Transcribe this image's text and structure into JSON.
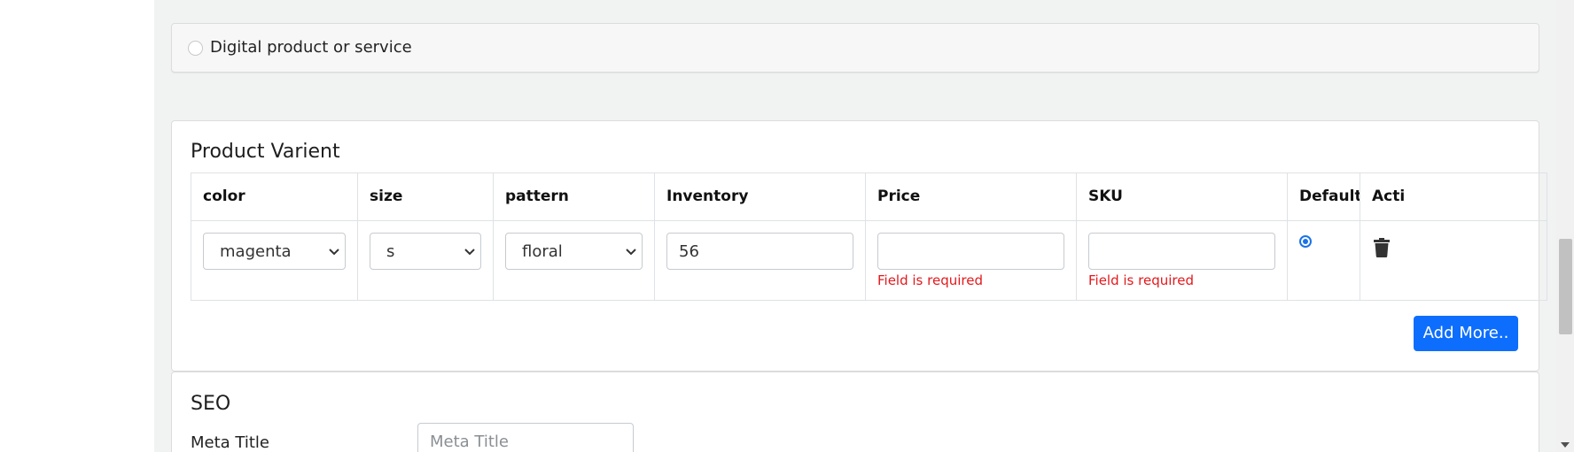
{
  "product_type": {
    "option_label": "Digital product or service",
    "selected": false
  },
  "variant": {
    "title": "Product Varient",
    "columns": [
      "color",
      "size",
      "pattern",
      "Inventory",
      "Price",
      "SKU",
      "Default",
      "Acti"
    ],
    "row": {
      "color": "magenta",
      "size": "s",
      "pattern": "floral",
      "inventory": "56",
      "price": "",
      "sku": "",
      "price_error": "Field is required",
      "sku_error": "Field is required",
      "default_selected": true,
      "delete_icon": "trash-icon"
    },
    "add_more_label": "Add More.."
  },
  "seo": {
    "title": "SEO",
    "meta_title_label": "Meta Title",
    "meta_title_placeholder": "Meta Title"
  },
  "chat": {
    "icon": "chat-bubble-icon"
  },
  "colors": {
    "primary": "#0d6efd",
    "error": "#e3181c",
    "chat": "#12a14b",
    "page_bg": "#f1f3f3"
  }
}
